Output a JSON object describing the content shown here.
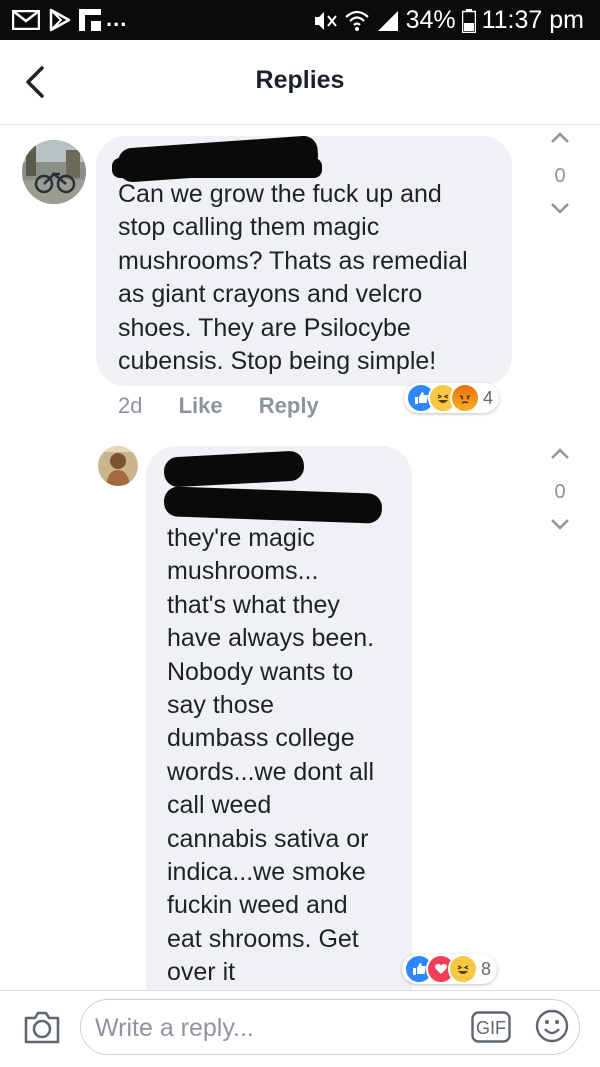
{
  "status_bar": {
    "battery": "34%",
    "time": "11:37 pm",
    "dots": "...",
    "icons": [
      "mail-icon",
      "play-store-icon",
      "flipboard-icon",
      "mute-icon",
      "wifi-icon",
      "signal-icon",
      "battery-icon"
    ]
  },
  "header": {
    "title": "Replies",
    "back_icon": "chevron-left-icon"
  },
  "comments": [
    {
      "text": "Can we grow the fuck up and\nstop calling them magic\nmushrooms? Thats as remedial\nas giant crayons and velcro\nshoes. They are Psilocybe\ncubensis. Stop being simple!",
      "time": "2d",
      "like": "Like",
      "reply": "Reply",
      "reaction_count": "4",
      "reactions": [
        "like",
        "haha",
        "angry"
      ],
      "votes": "0"
    },
    {
      "text": "they're magic\nmushrooms...\nthat's what they\nhave always been.\nNobody wants to\nsay those\ndumbass college\nwords...we dont all\ncall weed\ncannabis sativa or\nindica...we smoke\nfuckin weed and\neat shrooms. Get\nover it",
      "reaction_count": "8",
      "reactions": [
        "like",
        "love",
        "haha"
      ],
      "votes": "0"
    }
  ],
  "composer": {
    "placeholder": "Write a reply...",
    "gif_label": "GIF"
  },
  "colors": {
    "status_bar": "#0b0b0b",
    "bubble": "#f0f1f4",
    "like_blue": "#2d88ff",
    "love_red": "#f33e58",
    "haha_yellow": "#f7c843",
    "angry_orange": "#e9710f",
    "meta_gray": "#8d949e"
  }
}
